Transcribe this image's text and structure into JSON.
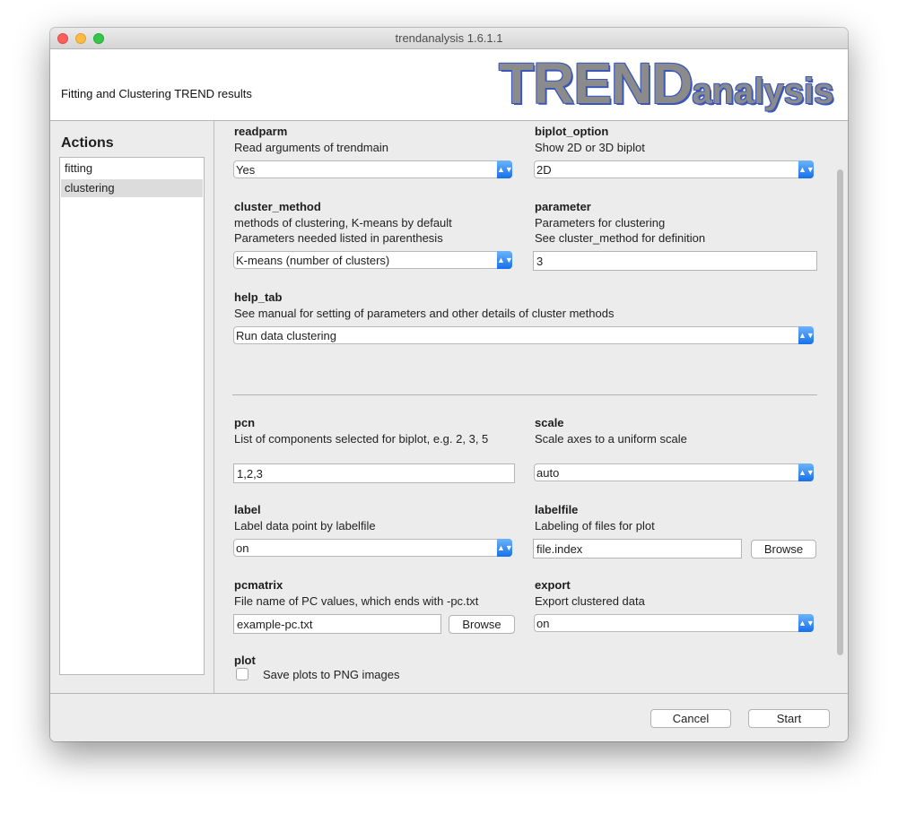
{
  "window": {
    "title": "trendanalysis 1.6.1.1"
  },
  "header": {
    "subtitle": "Fitting and Clustering TREND results",
    "logo_big": "TREND",
    "logo_small": "analysis"
  },
  "sidebar": {
    "heading": "Actions",
    "items": [
      {
        "label": "fitting"
      },
      {
        "label": "clustering"
      }
    ],
    "selected": "clustering"
  },
  "params": {
    "readparm": {
      "name": "readparm",
      "desc": "Read arguments of trendmain",
      "value": "Yes"
    },
    "biplot_option": {
      "name": "biplot_option",
      "desc": "Show 2D or 3D biplot",
      "value": "2D"
    },
    "cluster_method": {
      "name": "cluster_method",
      "desc1": "methods of clustering, K-means by default",
      "desc2": "Parameters needed listed in parenthesis",
      "value": "K-means (number of clusters)"
    },
    "parameter": {
      "name": "parameter",
      "desc1": "Parameters for clustering",
      "desc2": "See cluster_method for definition",
      "value": "3"
    },
    "help_tab": {
      "name": "help_tab",
      "desc": "See manual for setting of parameters and other details of cluster methods",
      "value": "Run data clustering"
    },
    "pcn": {
      "name": "pcn",
      "desc": "List of components selected for biplot, e.g. 2, 3, 5",
      "value": "1,2,3"
    },
    "scale": {
      "name": "scale",
      "desc": "Scale axes to a uniform scale",
      "value": "auto"
    },
    "label": {
      "name": "label",
      "desc": "Label data point by labelfile",
      "value": "on"
    },
    "labelfile": {
      "name": "labelfile",
      "desc": "Labeling of files for plot",
      "value": "file.index",
      "browse": "Browse"
    },
    "pcmatrix": {
      "name": "pcmatrix",
      "desc": "File name of PC values, which ends with -pc.txt",
      "value": "example-pc.txt",
      "browse": "Browse"
    },
    "export": {
      "name": "export",
      "desc": "Export clustered data",
      "value": "on"
    },
    "plot": {
      "name": "plot",
      "checkbox_label": "Save plots to PNG images",
      "checked": false
    }
  },
  "footer": {
    "cancel": "Cancel",
    "start": "Start"
  },
  "colors": {
    "accent": "#1670eb",
    "logo_fill": "#8b8b8b",
    "logo_outline": "#3b57ba"
  }
}
